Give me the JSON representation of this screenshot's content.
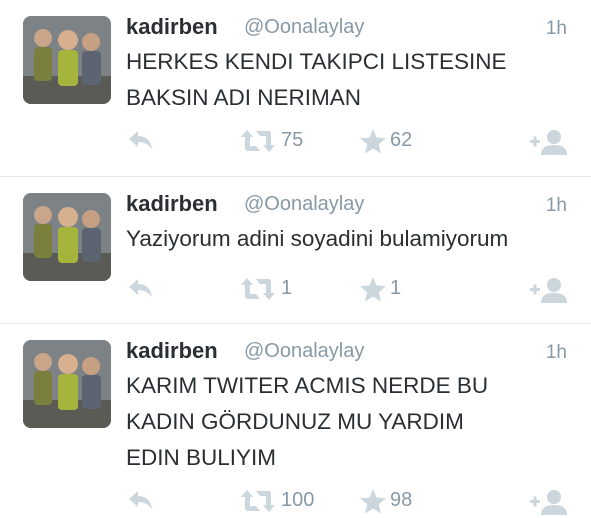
{
  "tweets": [
    {
      "name": "kadirben",
      "handle": "@Oonalaylay",
      "time": "1h",
      "text": "HERKES KENDI TAKIPCI LISTESINE\nBAKSIN ADI NERIMAN",
      "retweets": "75",
      "favorites": "62"
    },
    {
      "name": "kadirben",
      "handle": "@Oonalaylay",
      "time": "1h",
      "text": "Yaziyorum adini soyadini bulamiyorum",
      "retweets": "1",
      "favorites": "1"
    },
    {
      "name": "kadirben",
      "handle": "@Oonalaylay",
      "time": "1h",
      "text": "KARIM TWITER ACMIS NERDE BU\nKADIN GÖRDUNUZ MU YARDIM\nEDIN BULIYIM",
      "retweets": "100",
      "favorites": "98"
    }
  ],
  "icons": {
    "reply": "reply-icon",
    "retweet": "retweet-icon",
    "favorite": "star-icon",
    "follow": "follow-user-icon"
  },
  "colors": {
    "text": "#292f33",
    "muted": "#8899a6",
    "icon": "#ccd6dd",
    "divider": "#e1e8ed"
  }
}
